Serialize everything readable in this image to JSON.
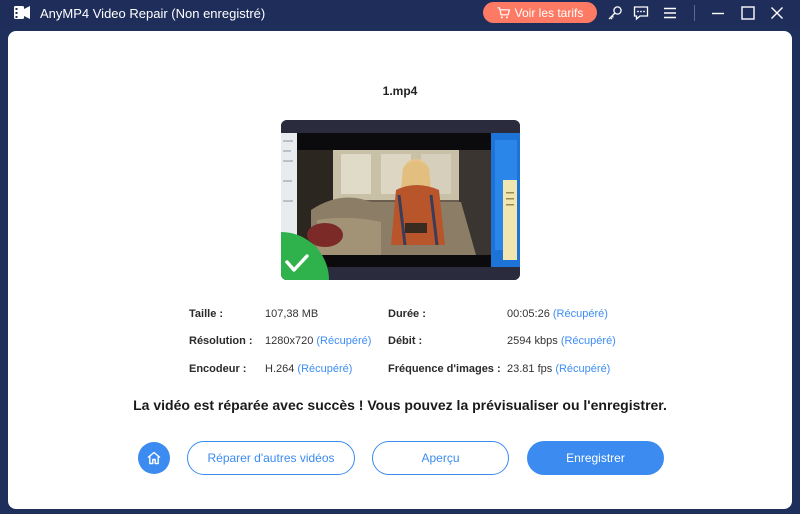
{
  "window": {
    "title": "AnyMP4 Video Repair (Non enregistré)",
    "pricing_label": "Voir les tarifs"
  },
  "icons": {
    "app_logo": "app-logo-icon",
    "cart": "cart-icon",
    "key": "key-icon",
    "feedback": "chat-icon",
    "menu": "menu-icon",
    "minimize": "minimize-icon",
    "maximize": "maximize-icon",
    "close": "close-icon",
    "home": "home-icon",
    "success": "checkmark-icon"
  },
  "colors": {
    "accent": "#3b8bf0",
    "pricing": "#ff7a64",
    "titlebar": "#1e2d5a",
    "success_badge": "#2fb24c"
  },
  "video": {
    "filename": "1.mp4"
  },
  "info": {
    "size_label": "Taille :",
    "size_value": "107,38 MB",
    "resolution_label": "Résolution :",
    "resolution_value": "1280x720",
    "resolution_status": "(Récupéré)",
    "encoder_label": "Encodeur :",
    "encoder_value": "H.264",
    "encoder_status": "(Récupéré)",
    "duration_label": "Durée :",
    "duration_value": "00:05:26",
    "duration_status": "(Récupéré)",
    "bitrate_label": "Débit :",
    "bitrate_value": "2594 kbps",
    "bitrate_status": "(Récupéré)",
    "framerate_label": "Fréquence d'images :",
    "framerate_value": "23.81 fps",
    "framerate_status": "(Récupéré)"
  },
  "message": "La vidéo est réparée avec succès ! Vous pouvez la prévisualiser ou l'enregistrer.",
  "actions": {
    "repair_other": "Réparer d'autres vidéos",
    "preview": "Aperçu",
    "save": "Enregistrer"
  }
}
